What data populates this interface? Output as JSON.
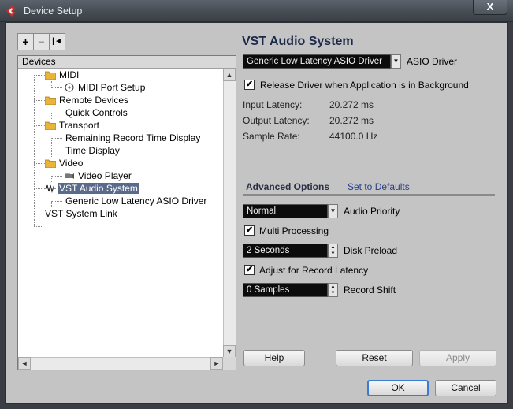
{
  "window": {
    "title": "Device Setup",
    "close_glyph": "X"
  },
  "toolbar": {
    "add_glyph": "+",
    "remove_glyph": "−",
    "reset_glyph": "|◄"
  },
  "tree": {
    "header": "Devices",
    "items": [
      {
        "label": "MIDI",
        "icon": "folder-icon"
      },
      {
        "label": "MIDI Port Setup",
        "icon": "midi-port-icon"
      },
      {
        "label": "Remote Devices",
        "icon": "folder-icon"
      },
      {
        "label": "Quick Controls",
        "icon": ""
      },
      {
        "label": "Transport",
        "icon": "folder-icon"
      },
      {
        "label": "Remaining Record Time Display",
        "icon": ""
      },
      {
        "label": "Time Display",
        "icon": ""
      },
      {
        "label": "Video",
        "icon": "folder-icon"
      },
      {
        "label": "Video Player",
        "icon": "video-icon"
      },
      {
        "label": "VST Audio System",
        "icon": "audio-wave-icon"
      },
      {
        "label": "Generic Low Latency ASIO Driver",
        "icon": ""
      },
      {
        "label": "VST System Link",
        "icon": ""
      }
    ],
    "selected_index": 9
  },
  "main": {
    "title": "VST Audio System",
    "driver_select": {
      "value": "Generic Low Latency ASIO Driver",
      "label": "ASIO Driver"
    },
    "release_driver": {
      "label": "Release Driver when Application is in Background",
      "checked": true
    },
    "info": [
      {
        "label": "Input Latency:",
        "value": "20.272 ms"
      },
      {
        "label": "Output Latency:",
        "value": "20.272 ms"
      },
      {
        "label": "Sample Rate:",
        "value": "44100.0 Hz"
      }
    ],
    "advanced": {
      "tab_label": "Advanced Options",
      "defaults_link": "Set to Defaults",
      "audio_priority": {
        "value": "Normal",
        "label": "Audio Priority"
      },
      "multi_processing": {
        "label": "Multi Processing",
        "checked": true
      },
      "disk_preload": {
        "value": "2 Seconds",
        "label": "Disk Preload"
      },
      "adjust_latency": {
        "label": "Adjust for Record Latency",
        "checked": true
      },
      "record_shift": {
        "value": "0 Samples",
        "label": "Record Shift"
      }
    },
    "buttons": {
      "help": "Help",
      "reset": "Reset",
      "apply": "Apply"
    }
  },
  "footer": {
    "ok": "OK",
    "cancel": "Cancel"
  },
  "colors": {
    "selection": "#5a6a8a",
    "combo_bg": "#0c0c0c",
    "default_button_border": "#3a7bd5",
    "title_text": "#1c2a4a"
  }
}
